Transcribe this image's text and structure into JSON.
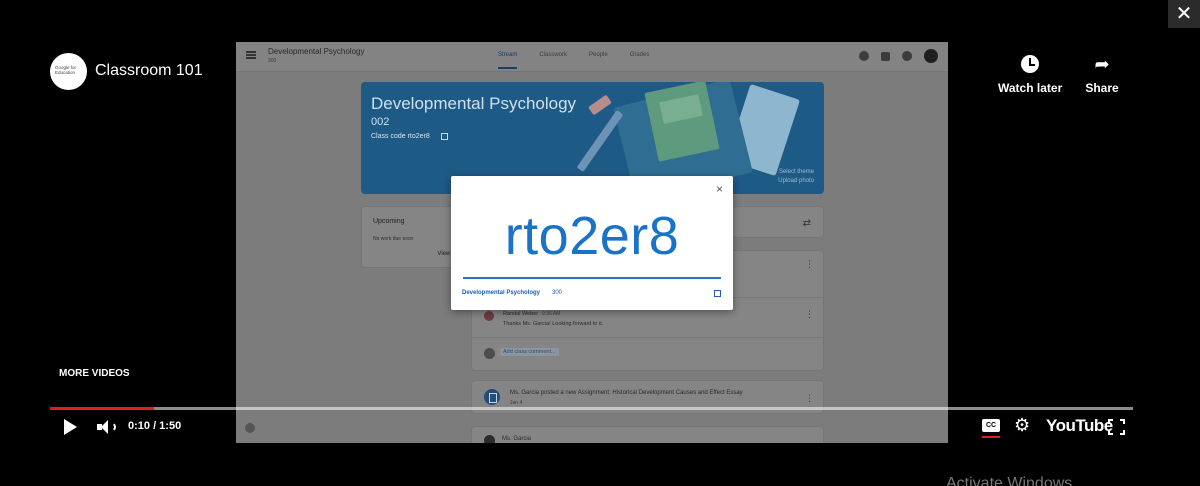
{
  "player": {
    "channel_name": "Classroom 101",
    "logo_text": "Google for Education",
    "close_glyph": "✕",
    "watch_later_label": "Watch later",
    "share_label": "Share",
    "more_videos_label": "MORE VIDEOS",
    "time": "0:10 / 1:50",
    "progress_percent": 9.6,
    "cc_label": "CC",
    "youtube_label": "YouTube",
    "accent_color": "#e11d1d"
  },
  "frame": {
    "topbar": {
      "course_title": "Developmental Psychology",
      "course_sub": "300",
      "tabs": [
        "Stream",
        "Classwork",
        "People",
        "Grades"
      ],
      "active_tab": "Stream"
    },
    "banner": {
      "title": "Developmental Psychology",
      "section": "002",
      "class_code_label": "Class code rto2er8",
      "select_theme": "Select theme",
      "upload_photo": "Upload photo",
      "color": "#1e5a86"
    },
    "upcoming": {
      "title": "Upcoming",
      "empty_text": "No work due soon",
      "view_all": "View all"
    },
    "comment": {
      "author": "Randal Weber",
      "time": "9:36 AM",
      "text": "Thanks Ms. Garcia! Looking forward to it."
    },
    "add_comment_placeholder": "Add class comment...",
    "assignment": {
      "text": "Ms. Garcia posted a new Assignment: Historical Development Causes and Effect Essay",
      "date": "Jan 4"
    },
    "next_post_author": "Ms. Garcia"
  },
  "modal": {
    "code": "rto2er8",
    "course": "Developmental Psychology",
    "section": "300",
    "close_glyph": "×",
    "code_color": "#1a73c8"
  },
  "overlay": {
    "activate_text": "Activate Windows"
  }
}
